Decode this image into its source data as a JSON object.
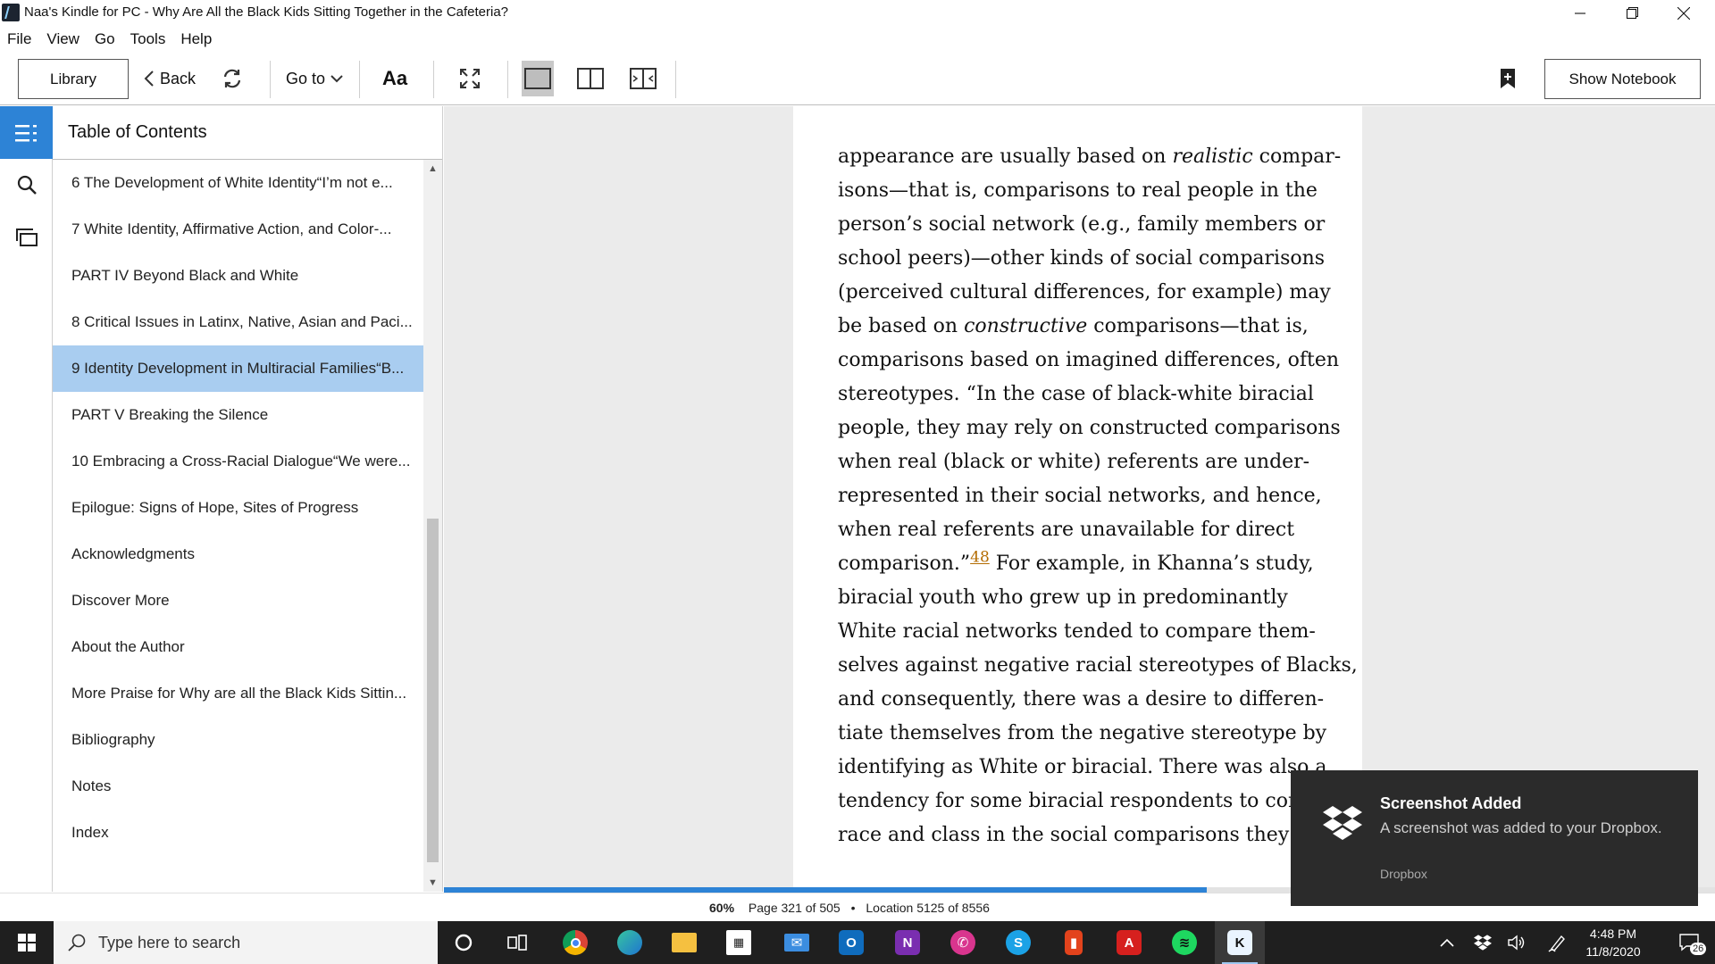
{
  "window": {
    "title": "Naa's Kindle for PC - Why Are All the Black Kids Sitting Together in the Cafeteria?"
  },
  "menu": [
    "File",
    "View",
    "Go",
    "Tools",
    "Help"
  ],
  "toolbar": {
    "library": "Library",
    "back": "Back",
    "goto": "Go to",
    "font": "Aa",
    "show_notebook": "Show Notebook"
  },
  "toc": {
    "title": "Table of Contents",
    "items": [
      "6 The Development of White Identity“I’m not e...",
      "7 White Identity, Affirmative Action, and Color-...",
      "PART IV Beyond Black and White",
      "8 Critical Issues in Latinx, Native, Asian and Paci...",
      "9 Identity Development in Multiracial Families“B...",
      "PART V Breaking the Silence",
      "10 Embracing a Cross-Racial Dialogue“We were...",
      "Epilogue: Signs of Hope, Sites of Progress",
      "Acknowledgments",
      "Discover More",
      "About the Author",
      "More Praise for Why are all the Black Kids Sittin...",
      "Bibliography",
      "Notes",
      "Index"
    ],
    "selected_index": 4
  },
  "page": {
    "lines": [
      [
        "appearance are usually based on ",
        "realistic",
        " compar-"
      ],
      [
        "isons—that is, comparisons to real people in the"
      ],
      [
        "person’s social network (e.g., family members or"
      ],
      [
        "school peers)—other kinds of social comparisons"
      ],
      [
        "(perceived cultural differences, for example) may"
      ],
      [
        "be based on ",
        "constructive",
        " comparisons—that is,"
      ],
      [
        "comparisons based on imagined differences, often"
      ],
      [
        "stereotypes. “In the case of black-white biracial"
      ],
      [
        "people, they may rely on constructed comparisons"
      ],
      [
        "when real (black or white) referents are under-"
      ],
      [
        "represented in their social networks, and hence,"
      ],
      [
        "when real referents are unavailable for direct"
      ],
      [
        "comparison.”",
        "48",
        " For example, in Khanna’s study,"
      ],
      [
        "biracial youth who grew up in predominantly"
      ],
      [
        "White racial networks tended to compare them-"
      ],
      [
        "selves against negative racial stereotypes of Blacks,"
      ],
      [
        "and consequently, there was a desire to differen-"
      ],
      [
        "tiate themselves from the negative stereotype by"
      ],
      [
        "identifying as White or biracial. There was also a"
      ],
      [
        "tendency for some biracial respondents to confla"
      ],
      [
        "race and class in the social comparisons they ma"
      ]
    ]
  },
  "status": {
    "percent": "60%",
    "page": "Page 321 of 505",
    "separator": "•",
    "location": "Location 5125 of 8556",
    "progress_fraction": 0.6
  },
  "toast": {
    "title": "Screenshot Added",
    "body": "A screenshot was added to your Dropbox.",
    "source": "Dropbox"
  },
  "taskbar": {
    "search_placeholder": "Type here to search",
    "time": "4:48 PM",
    "date": "11/8/2020",
    "notification_count": "26",
    "apps": [
      "cortana-icon",
      "task-view-icon",
      "chrome-icon",
      "edge-icon",
      "file-explorer-icon",
      "store-icon",
      "mail-icon",
      "outlook-icon",
      "onenote-icon",
      "whatsapp-icon",
      "skype-icon",
      "office-icon",
      "acrobat-icon",
      "spotify-icon",
      "kindle-icon"
    ]
  },
  "colors": {
    "accent": "#2d83d6",
    "toc_selected": "#a9cdf0",
    "footnote_link": "#b36b00"
  }
}
